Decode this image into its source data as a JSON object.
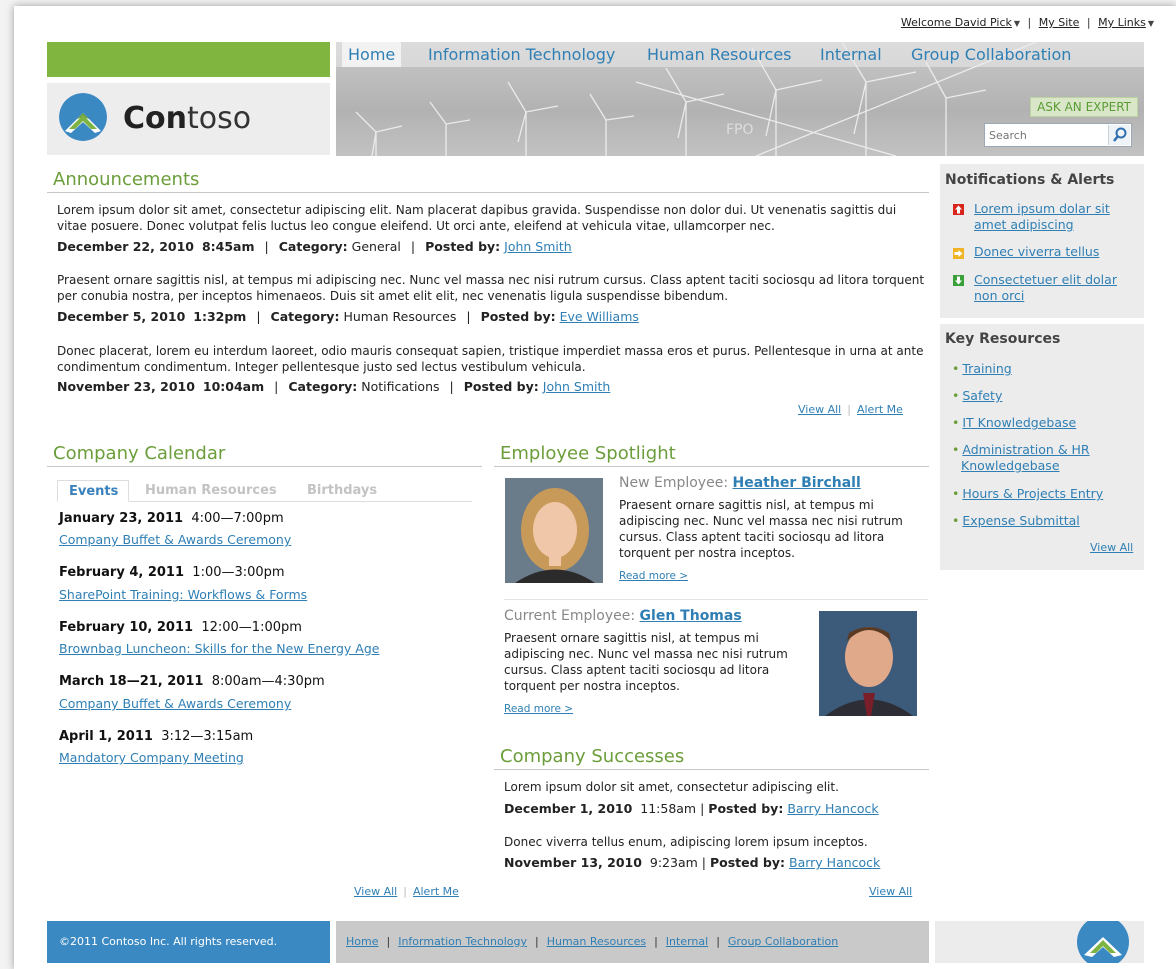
{
  "toplinks": {
    "welcome": "Welcome David Pick",
    "my_site": "My Site",
    "my_links": "My Links"
  },
  "logo": {
    "bold": "Con",
    "rest": "toso"
  },
  "nav": [
    "Home",
    "Information Technology",
    "Human Resources",
    "Internal",
    "Group Collaboration"
  ],
  "banner": {
    "ask_expert": "ASK AN EXPERT",
    "search_placeholder": "Search",
    "fpo": "FPO"
  },
  "announcements": {
    "title": "Announcements",
    "items": [
      {
        "text": "Lorem ipsum dolor sit amet, consectetur adipiscing elit. Nam placerat dapibus gravida. Suspendisse non dolor dui. Ut venenatis sagittis dui vitae posuere. Donec volutpat felis luctus leo congue eleifend. Ut orci ante, eleifend at vehicula vitae, ullamcorper nec.",
        "date": "December 22, 2010",
        "time": "8:45am",
        "category_label": "Category:",
        "category": "General",
        "posted_label": "Posted by:",
        "author": "John Smith"
      },
      {
        "text": "Praesent ornare sagittis nisl, at tempus mi adipiscing nec. Nunc vel massa nec nisi rutrum cursus. Class aptent taciti sociosqu ad litora torquent per conubia nostra, per inceptos himenaeos. Duis sit amet elit elit, nec venenatis ligula suspendisse bibendum.",
        "date": "December 5, 2010",
        "time": "1:32pm",
        "category_label": "Category:",
        "category": "Human Resources",
        "posted_label": "Posted by:",
        "author": "Eve Williams"
      },
      {
        "text": "Donec placerat, lorem eu interdum laoreet, odio mauris consequat sapien, tristique imperdiet massa eros et purus. Pellentesque in urna at ante condimentum condimentum. Integer pellentesque justo sed lectus vestibulum vehicula.",
        "date": "November 23, 2010",
        "time": "10:04am",
        "category_label": "Category:",
        "category": "Notifications",
        "posted_label": "Posted by:",
        "author": "John Smith"
      }
    ],
    "view_all": "View All",
    "alert_me": "Alert Me"
  },
  "calendar": {
    "title": "Company Calendar",
    "tabs": [
      "Events",
      "Human Resources",
      "Birthdays"
    ],
    "events": [
      {
        "date": "January 23, 2011",
        "time": "4:00—7:00pm",
        "name": "Company Buffet & Awards Ceremony"
      },
      {
        "date": "February 4, 2011",
        "time": "1:00—3:00pm",
        "name": "SharePoint Training: Workflows & Forms"
      },
      {
        "date": "February 10, 2011",
        "time": "12:00—1:00pm",
        "name": "Brownbag Luncheon: Skills for the New Energy Age"
      },
      {
        "date": "March 18—21, 2011",
        "time": "8:00am—4:30pm",
        "name": "Company Buffet & Awards Ceremony"
      },
      {
        "date": "April 1, 2011",
        "time": "3:12—3:15am",
        "name": "Mandatory Company Meeting"
      }
    ],
    "view_all": "View All",
    "alert_me": "Alert Me"
  },
  "spotlight": {
    "title": "Employee Spotlight",
    "new": {
      "label": "New Employee:",
      "name": "Heather Birchall",
      "text": "Praesent ornare sagittis nisl, at tempus mi adipiscing nec. Nunc vel massa nec nisi rutrum cursus. Class aptent taciti sociosqu ad litora torquent per nostra inceptos.",
      "read_more": "Read more >"
    },
    "current": {
      "label": "Current Employee:",
      "name": "Glen Thomas",
      "text": "Praesent ornare sagittis nisl, at tempus mi adipiscing nec. Nunc vel massa nec nisi rutrum cursus. Class aptent taciti sociosqu ad litora torquent per nostra inceptos.",
      "read_more": "Read more >"
    }
  },
  "successes": {
    "title": "Company Successes",
    "items": [
      {
        "text": "Lorem ipsum dolor sit amet, consectetur adipiscing elit.",
        "date": "December 1, 2010",
        "time": "11:58am",
        "posted_label": "Posted by:",
        "author": "Barry Hancock"
      },
      {
        "text": "Donec viverra tellus enum, adipiscing lorem ipsum inceptos.",
        "date": "November 13, 2010",
        "time": "9:23am",
        "posted_label": "Posted by:",
        "author": "Barry Hancock"
      }
    ],
    "view_all": "View All"
  },
  "notifications": {
    "title": "Notifications & Alerts",
    "items": [
      {
        "text": "Lorem ipsum dolar sit amet adipiscing",
        "icon": "up-arrow-icon",
        "color": "#d9251c"
      },
      {
        "text": "Donec viverra tellus",
        "icon": "right-arrow-icon",
        "color": "#f0b323"
      },
      {
        "text": "Consectetuer elit dolar non orci",
        "icon": "down-arrow-icon",
        "color": "#3aa13a"
      }
    ]
  },
  "resources": {
    "title": "Key Resources",
    "items": [
      "Training",
      "Safety",
      "IT Knowledgebase",
      "Administration & HR Knowledgebase",
      "Hours & Projects Entry",
      "Expense Submittal"
    ],
    "view_all": "View All"
  },
  "footer": {
    "copyright": "©2011 Contoso Inc. All rights reserved.",
    "nav": [
      "Home",
      "Information Technology",
      "Human Resources",
      "Internal",
      "Group Collaboration"
    ]
  },
  "colors": {
    "accent_green": "#6b9e3a",
    "link_blue": "#2f7fb5",
    "footer_blue": "#3b89c3"
  }
}
